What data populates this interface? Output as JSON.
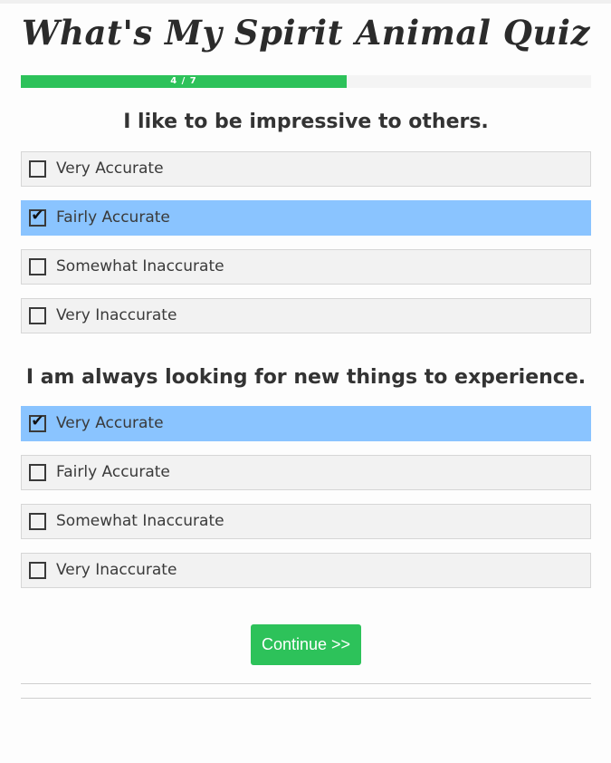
{
  "quiz": {
    "title": "What's My Spirit Animal Quiz"
  },
  "progress": {
    "label": "4 / 7",
    "current": 4,
    "total": 7,
    "fraction": 0.5714
  },
  "questions": [
    {
      "text": "I like to be impressive to others.",
      "options": [
        {
          "label": "Very Accurate",
          "checked": false
        },
        {
          "label": "Fairly Accurate",
          "checked": true
        },
        {
          "label": "Somewhat Inaccurate",
          "checked": false
        },
        {
          "label": "Very Inaccurate",
          "checked": false
        }
      ]
    },
    {
      "text": "I am always looking for new things to experience.",
      "options": [
        {
          "label": "Very Accurate",
          "checked": true
        },
        {
          "label": "Fairly Accurate",
          "checked": false
        },
        {
          "label": "Somewhat Inaccurate",
          "checked": false
        },
        {
          "label": "Very Inaccurate",
          "checked": false
        }
      ]
    }
  ],
  "actions": {
    "continue_label": "Continue >>"
  },
  "colors": {
    "progress_fill": "#2dc25a",
    "selected_option": "#8ac4ff",
    "option_background": "#f2f2f2",
    "continue_button": "#2dc25a"
  }
}
